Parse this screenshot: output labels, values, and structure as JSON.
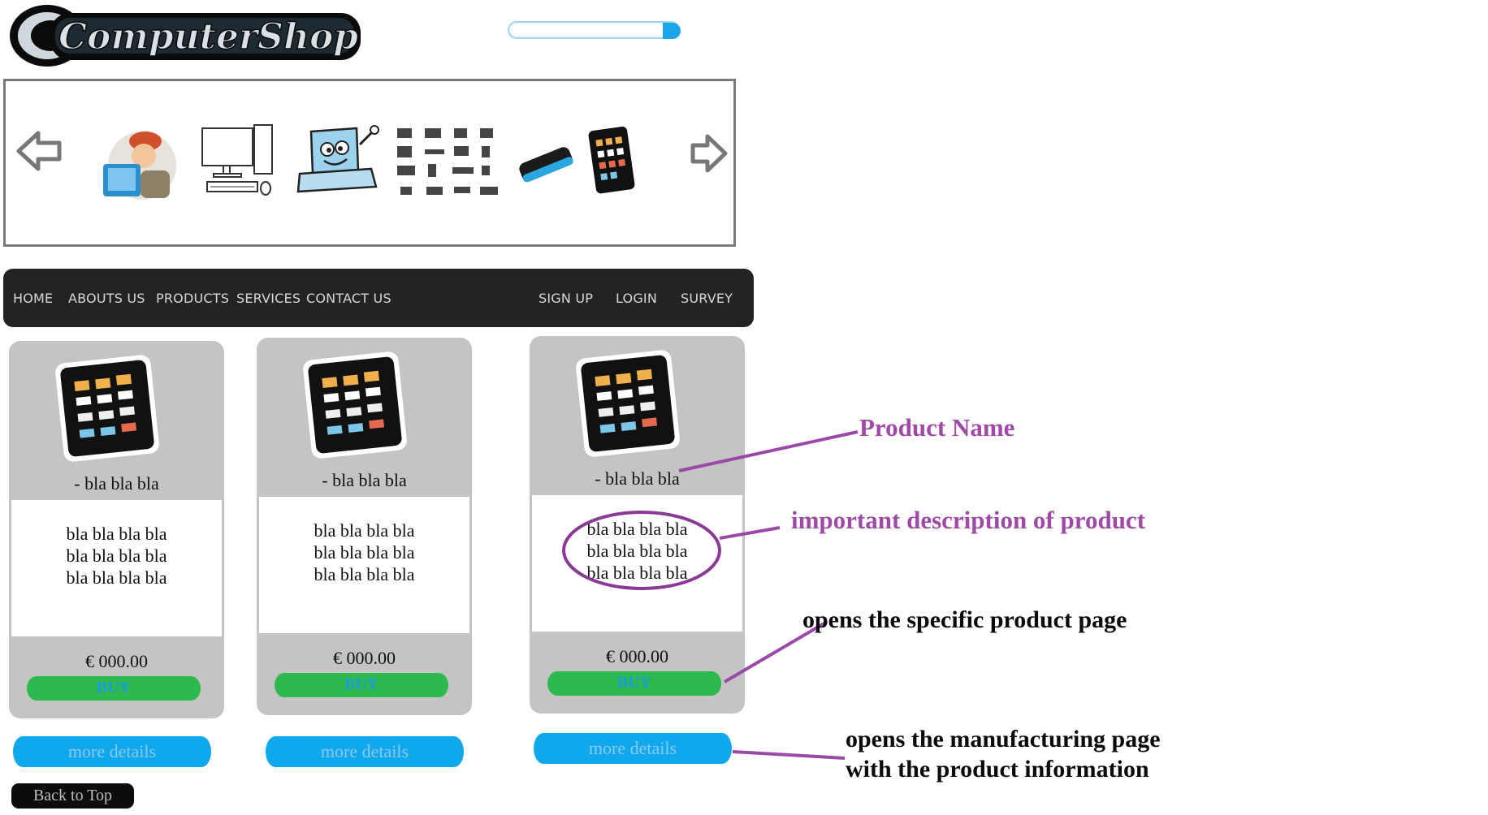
{
  "header": {
    "logo_text": "ComputerShop",
    "search_placeholder": ""
  },
  "carousel": {
    "items": [
      "technician-icon",
      "desktop-computer-icon",
      "laptop-cartoon-icon",
      "devices-grid-icon",
      "phone-icon",
      "tablet-icon"
    ]
  },
  "nav": {
    "left": [
      "HOME",
      "ABOUTS US",
      "PRODUCTS",
      "SERVICES",
      "CONTACT US"
    ],
    "right": [
      "SIGN UP",
      "LOGIN",
      "SURVEY"
    ]
  },
  "products": [
    {
      "name": "-  bla bla bla",
      "desc": [
        "bla bla bla bla",
        "bla bla bla bla",
        "bla bla bla bla"
      ],
      "price": "€ 000.00",
      "buy": "BUY",
      "more": "more details"
    },
    {
      "name": "-  bla bla bla",
      "desc": [
        "bla bla bla bla",
        "bla bla bla bla",
        "bla bla bla bla"
      ],
      "price": "€ 000.00",
      "buy": "BUY",
      "more": "more details"
    },
    {
      "name": "-  bla bla bla",
      "desc": [
        "bla bla bla bla",
        "bla bla bla bla",
        "bla bla bla bla"
      ],
      "price": "€ 000.00",
      "buy": "BUY",
      "more": "more details"
    }
  ],
  "back_to_top": "Back to Top",
  "annotations": {
    "product_name": "Product Name",
    "description": "important description of product",
    "buy_note": "opens the specific product page",
    "details_note_1": "opens the manufacturing page",
    "details_note_2": "with the product information"
  },
  "colors": {
    "annotation_purple": "#a04aa8",
    "buy_green": "#2db94d",
    "details_blue": "#10a8ec",
    "nav_bg": "#232323"
  }
}
